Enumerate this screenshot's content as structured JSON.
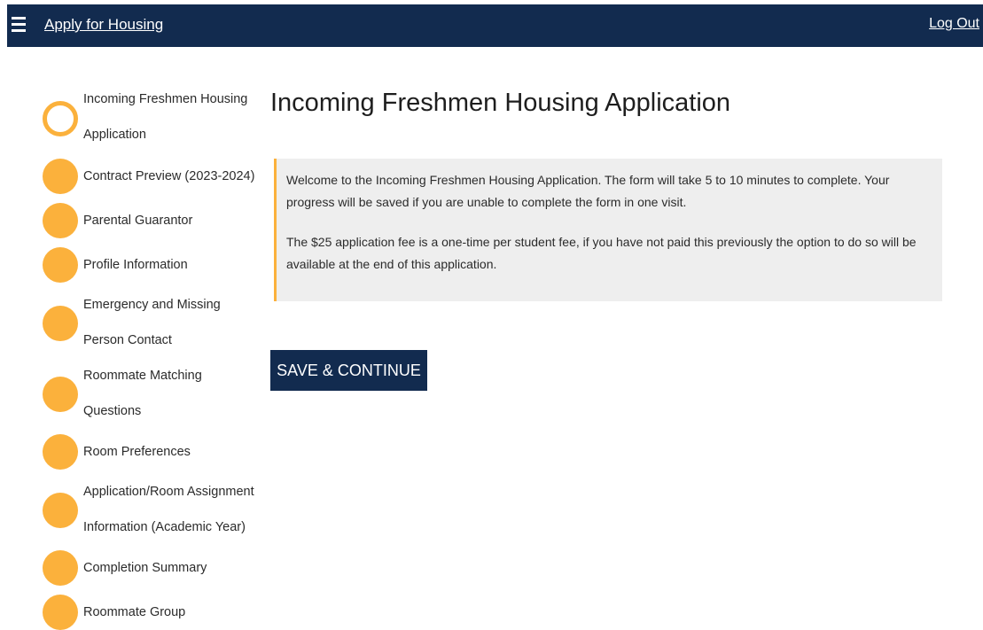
{
  "header": {
    "menu_icon": "hamburger-menu-icon",
    "title": "Apply for Housing",
    "logout_label": "Log Out",
    "background_color": "#122b4f"
  },
  "sidebar": {
    "accent_color": "#fbb13c",
    "steps": [
      {
        "label": "Incoming Freshmen Housing\nApplication",
        "state": "current"
      },
      {
        "label": "Contract Preview (2023-2024)",
        "state": "pending"
      },
      {
        "label": "Parental Guarantor",
        "state": "pending"
      },
      {
        "label": "Profile Information",
        "state": "pending"
      },
      {
        "label": "Emergency and Missing\nPerson Contact",
        "state": "pending"
      },
      {
        "label": "Roommate Matching\nQuestions",
        "state": "pending"
      },
      {
        "label": "Room Preferences",
        "state": "pending"
      },
      {
        "label": "Application/Room Assignment\nInformation (Academic Year)",
        "state": "pending"
      },
      {
        "label": "Completion Summary",
        "state": "pending"
      },
      {
        "label": "Roommate Group",
        "state": "pending"
      }
    ]
  },
  "main": {
    "title": "Incoming Freshmen Housing Application",
    "notice": {
      "paragraph_1": "Welcome to the Incoming Freshmen Housing Application. The form will take 5 to 10 minutes to complete. Your progress will be saved if you are unable to complete the form in one visit.",
      "paragraph_2": "The $25 application fee is a one-time per student fee, if you have not paid this previously the option to do so will be available at the end of this application."
    },
    "save_button_label": "SAVE & CONTINUE"
  }
}
